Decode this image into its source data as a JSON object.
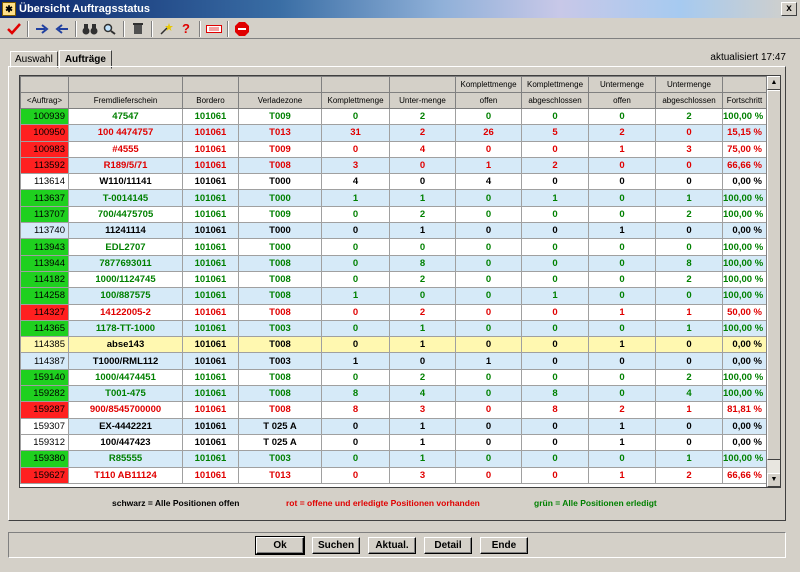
{
  "window": {
    "title": "Übersicht Auftragsstatus",
    "close_glyph": "x"
  },
  "toolbar": {
    "icons": [
      "check-icon",
      "forward-arrow-icon",
      "back-arrow-icon",
      "binoculars-icon",
      "magnifier-icon",
      "trash-icon",
      "star-wand-icon",
      "help-question-icon",
      "keyboard-icon",
      "stop-sign-icon"
    ]
  },
  "tabs": [
    {
      "label": "Auswahl"
    },
    {
      "label": "Aufträge"
    }
  ],
  "updated_label": "aktualisiert 17:47",
  "columns": [
    {
      "top": "",
      "bottom": "<Auftrag>"
    },
    {
      "top": "",
      "bottom": "Fremdlieferschein"
    },
    {
      "top": "",
      "bottom": "Bordero"
    },
    {
      "top": "",
      "bottom": "Verladezone"
    },
    {
      "top": "",
      "bottom": "Komplettmenge"
    },
    {
      "top": "",
      "bottom": "Unter-menge"
    },
    {
      "top": "Komplettmenge",
      "bottom": "offen"
    },
    {
      "top": "Komplettmenge",
      "bottom": "abgeschlossen"
    },
    {
      "top": "Untermenge",
      "bottom": "offen"
    },
    {
      "top": "Untermenge",
      "bottom": "abgeschlossen"
    },
    {
      "top": "",
      "bottom": "Fortschritt"
    }
  ],
  "colors": {
    "green": "#1fd01f",
    "red": "#ff2020",
    "blue": "#d6eaf8",
    "yellow": "#fff8b0",
    "text_green": "#008000",
    "text_red": "#e00000",
    "text_black": "#000000"
  },
  "rows": [
    {
      "cells": [
        "100939",
        "47547",
        "101061",
        "T009",
        "0",
        "2",
        "0",
        "0",
        "0",
        "2",
        "100,00 %"
      ],
      "status": "green",
      "bg": "white"
    },
    {
      "cells": [
        "100950",
        "100 4474757",
        "101061",
        "T013",
        "31",
        "2",
        "26",
        "5",
        "2",
        "0",
        "15,15 %"
      ],
      "status": "red",
      "bg": "blue"
    },
    {
      "cells": [
        "100983",
        "#4555",
        "101061",
        "T009",
        "0",
        "4",
        "0",
        "0",
        "1",
        "3",
        "75,00 %"
      ],
      "status": "red",
      "bg": "white"
    },
    {
      "cells": [
        "113592",
        "R189/5/71",
        "101061",
        "T008",
        "3",
        "0",
        "1",
        "2",
        "0",
        "0",
        "66,66 %"
      ],
      "status": "red",
      "bg": "blue"
    },
    {
      "cells": [
        "113614",
        "W110/11141",
        "101061",
        "T000",
        "4",
        "0",
        "4",
        "0",
        "0",
        "0",
        "0,00 %"
      ],
      "status": "white",
      "bg": "white"
    },
    {
      "cells": [
        "113637",
        "T-0014145",
        "101061",
        "T000",
        "1",
        "1",
        "0",
        "1",
        "0",
        "1",
        "100,00 %"
      ],
      "status": "green",
      "bg": "blue"
    },
    {
      "cells": [
        "113707",
        "700/4475705",
        "101061",
        "T009",
        "0",
        "2",
        "0",
        "0",
        "0",
        "2",
        "100,00 %"
      ],
      "status": "green",
      "bg": "white"
    },
    {
      "cells": [
        "113740",
        "11241114",
        "101061",
        "T000",
        "0",
        "1",
        "0",
        "0",
        "1",
        "0",
        "0,00 %"
      ],
      "status": "blue",
      "bg": "blue"
    },
    {
      "cells": [
        "113943",
        "EDL2707",
        "101061",
        "T000",
        "0",
        "0",
        "0",
        "0",
        "0",
        "0",
        "100,00 %"
      ],
      "status": "green",
      "bg": "white"
    },
    {
      "cells": [
        "113944",
        "7877693011",
        "101061",
        "T008",
        "0",
        "8",
        "0",
        "0",
        "0",
        "8",
        "100,00 %"
      ],
      "status": "green",
      "bg": "blue"
    },
    {
      "cells": [
        "114182",
        "1000/1124745",
        "101061",
        "T008",
        "0",
        "2",
        "0",
        "0",
        "0",
        "2",
        "100,00 %"
      ],
      "status": "green",
      "bg": "white"
    },
    {
      "cells": [
        "114258",
        "100/887575",
        "101061",
        "T008",
        "1",
        "0",
        "0",
        "1",
        "0",
        "0",
        "100,00 %"
      ],
      "status": "green",
      "bg": "blue"
    },
    {
      "cells": [
        "114327",
        "14122005-2",
        "101061",
        "T008",
        "0",
        "2",
        "0",
        "0",
        "1",
        "1",
        "50,00 %"
      ],
      "status": "red",
      "bg": "white"
    },
    {
      "cells": [
        "114365",
        "1178-TT-1000",
        "101061",
        "T003",
        "0",
        "1",
        "0",
        "0",
        "0",
        "1",
        "100,00 %"
      ],
      "status": "green",
      "bg": "blue"
    },
    {
      "cells": [
        "114385",
        "abse143",
        "101061",
        "T008",
        "0",
        "1",
        "0",
        "0",
        "1",
        "0",
        "0,00 %"
      ],
      "status": "yellow",
      "bg": "yellow"
    },
    {
      "cells": [
        "114387",
        "T1000/RML112",
        "101061",
        "T003",
        "1",
        "0",
        "1",
        "0",
        "0",
        "0",
        "0,00 %"
      ],
      "status": "blue",
      "bg": "blue"
    },
    {
      "cells": [
        "159140",
        "1000/4474451",
        "101061",
        "T008",
        "0",
        "2",
        "0",
        "0",
        "0",
        "2",
        "100,00 %"
      ],
      "status": "green",
      "bg": "white"
    },
    {
      "cells": [
        "159282",
        "T001-475",
        "101061",
        "T008",
        "8",
        "4",
        "0",
        "8",
        "0",
        "4",
        "100,00 %"
      ],
      "status": "green",
      "bg": "blue"
    },
    {
      "cells": [
        "159287",
        "900/8545700000",
        "101061",
        "T008",
        "8",
        "3",
        "0",
        "8",
        "2",
        "1",
        "81,81 %"
      ],
      "status": "red",
      "bg": "white"
    },
    {
      "cells": [
        "159307",
        "EX-4442221",
        "101061",
        "T 025 A",
        "0",
        "1",
        "0",
        "0",
        "1",
        "0",
        "0,00 %"
      ],
      "status": "white",
      "bg": "blue"
    },
    {
      "cells": [
        "159312",
        "100/447423",
        "101061",
        "T 025 A",
        "0",
        "1",
        "0",
        "0",
        "1",
        "0",
        "0,00 %"
      ],
      "status": "white",
      "bg": "white"
    },
    {
      "cells": [
        "159380",
        "R85555",
        "101061",
        "T003",
        "0",
        "1",
        "0",
        "0",
        "0",
        "1",
        "100,00 %"
      ],
      "status": "green",
      "bg": "blue"
    },
    {
      "cells": [
        "159627",
        "T110 AB11124",
        "101061",
        "T013",
        "0",
        "3",
        "0",
        "0",
        "1",
        "2",
        "66,66 %"
      ],
      "status": "red",
      "bg": "white"
    }
  ],
  "legend": {
    "black": "schwarz = Alle Positionen offen",
    "red": "rot = offene und erledigte Positionen vorhanden",
    "green": "grün = Alle Positionen erledigt"
  },
  "buttons": [
    {
      "label": "Ok",
      "name": "ok-button",
      "default": true
    },
    {
      "label": "Suchen",
      "name": "suchen-button"
    },
    {
      "label": "Aktual.",
      "name": "aktualisieren-button"
    },
    {
      "label": "Detail",
      "name": "detail-button"
    },
    {
      "label": "Ende",
      "name": "ende-button"
    }
  ]
}
